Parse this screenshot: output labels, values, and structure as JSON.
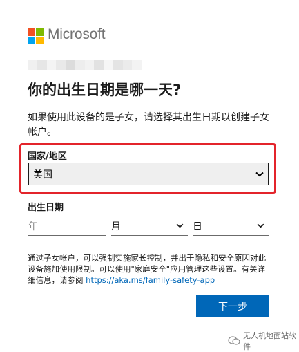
{
  "brand": {
    "name": "Microsoft"
  },
  "page": {
    "title": "你的出生日期是哪一天?",
    "description": "如果使用此设备的是子女，请选择其出生日期以创建子女帐户。"
  },
  "region": {
    "label": "国家/地区",
    "selected": "美国",
    "highlight_color": "#e3242b"
  },
  "dob": {
    "label": "出生日期",
    "year_placeholder": "年",
    "month_value": "月",
    "day_value": "日"
  },
  "info": {
    "text": "通过子女帐户，可以强制实施家长控制，并出于隐私和安全原因对此设备施加使用限制。可以使用\"家庭安全\"应用管理这些设置。有关详细信息，请参阅 ",
    "link": "https://aka.ms/family-safety-app"
  },
  "buttons": {
    "next": "下一步",
    "color": "#0067b8"
  },
  "watermark": {
    "text": "无人机地面站软件"
  }
}
